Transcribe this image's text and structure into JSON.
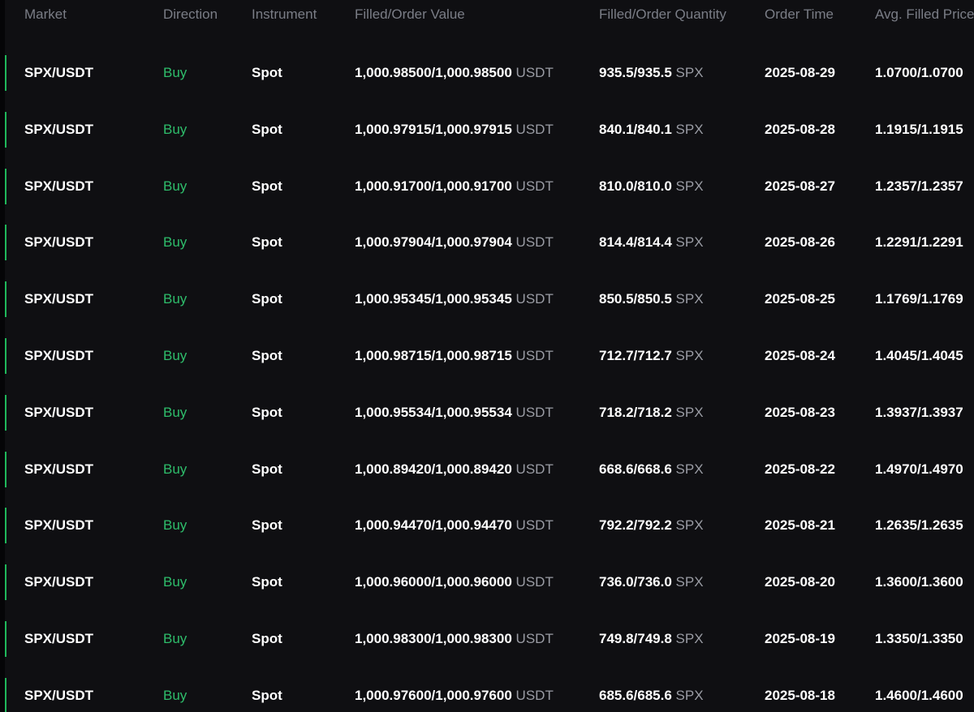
{
  "headers": {
    "market": "Market",
    "direction": "Direction",
    "instrument": "Instrument",
    "value": "Filled/Order Value",
    "quantity": "Filled/Order Quantity",
    "time": "Order Time",
    "price": "Avg. Filled Price"
  },
  "colors": {
    "buy": "#2ebd6b",
    "indicator": "#1fb85b",
    "background": "#0f0f12"
  },
  "rows": [
    {
      "market": "SPX/USDT",
      "direction": "Buy",
      "instrument": "Spot",
      "value": "1,000.98500/1,000.98500",
      "value_unit": "USDT",
      "quantity": "935.5/935.5",
      "quantity_unit": "SPX",
      "time": "2025-08-29",
      "price": "1.0700/1.0700"
    },
    {
      "market": "SPX/USDT",
      "direction": "Buy",
      "instrument": "Spot",
      "value": "1,000.97915/1,000.97915",
      "value_unit": "USDT",
      "quantity": "840.1/840.1",
      "quantity_unit": "SPX",
      "time": "2025-08-28",
      "price": "1.1915/1.1915"
    },
    {
      "market": "SPX/USDT",
      "direction": "Buy",
      "instrument": "Spot",
      "value": "1,000.91700/1,000.91700",
      "value_unit": "USDT",
      "quantity": "810.0/810.0",
      "quantity_unit": "SPX",
      "time": "2025-08-27",
      "price": "1.2357/1.2357"
    },
    {
      "market": "SPX/USDT",
      "direction": "Buy",
      "instrument": "Spot",
      "value": "1,000.97904/1,000.97904",
      "value_unit": "USDT",
      "quantity": "814.4/814.4",
      "quantity_unit": "SPX",
      "time": "2025-08-26",
      "price": "1.2291/1.2291"
    },
    {
      "market": "SPX/USDT",
      "direction": "Buy",
      "instrument": "Spot",
      "value": "1,000.95345/1,000.95345",
      "value_unit": "USDT",
      "quantity": "850.5/850.5",
      "quantity_unit": "SPX",
      "time": "2025-08-25",
      "price": "1.1769/1.1769"
    },
    {
      "market": "SPX/USDT",
      "direction": "Buy",
      "instrument": "Spot",
      "value": "1,000.98715/1,000.98715",
      "value_unit": "USDT",
      "quantity": "712.7/712.7",
      "quantity_unit": "SPX",
      "time": "2025-08-24",
      "price": "1.4045/1.4045"
    },
    {
      "market": "SPX/USDT",
      "direction": "Buy",
      "instrument": "Spot",
      "value": "1,000.95534/1,000.95534",
      "value_unit": "USDT",
      "quantity": "718.2/718.2",
      "quantity_unit": "SPX",
      "time": "2025-08-23",
      "price": "1.3937/1.3937"
    },
    {
      "market": "SPX/USDT",
      "direction": "Buy",
      "instrument": "Spot",
      "value": "1,000.89420/1,000.89420",
      "value_unit": "USDT",
      "quantity": "668.6/668.6",
      "quantity_unit": "SPX",
      "time": "2025-08-22",
      "price": "1.4970/1.4970"
    },
    {
      "market": "SPX/USDT",
      "direction": "Buy",
      "instrument": "Spot",
      "value": "1,000.94470/1,000.94470",
      "value_unit": "USDT",
      "quantity": "792.2/792.2",
      "quantity_unit": "SPX",
      "time": "2025-08-21",
      "price": "1.2635/1.2635"
    },
    {
      "market": "SPX/USDT",
      "direction": "Buy",
      "instrument": "Spot",
      "value": "1,000.96000/1,000.96000",
      "value_unit": "USDT",
      "quantity": "736.0/736.0",
      "quantity_unit": "SPX",
      "time": "2025-08-20",
      "price": "1.3600/1.3600"
    },
    {
      "market": "SPX/USDT",
      "direction": "Buy",
      "instrument": "Spot",
      "value": "1,000.98300/1,000.98300",
      "value_unit": "USDT",
      "quantity": "749.8/749.8",
      "quantity_unit": "SPX",
      "time": "2025-08-19",
      "price": "1.3350/1.3350"
    },
    {
      "market": "SPX/USDT",
      "direction": "Buy",
      "instrument": "Spot",
      "value": "1,000.97600/1,000.97600",
      "value_unit": "USDT",
      "quantity": "685.6/685.6",
      "quantity_unit": "SPX",
      "time": "2025-08-18",
      "price": "1.4600/1.4600"
    }
  ]
}
